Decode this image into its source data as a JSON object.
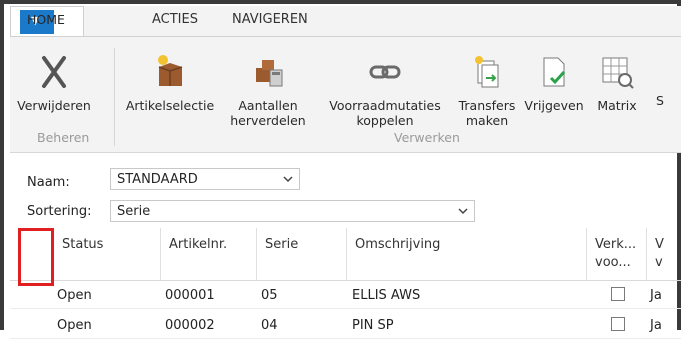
{
  "tabs": [
    {
      "label": "HOME",
      "active": true
    },
    {
      "label": "ACTIES"
    },
    {
      "label": "NAVIGEREN"
    }
  ],
  "ribbon": {
    "groups": {
      "beheren": "Beheren",
      "verwerken": "Verwerken"
    },
    "buttons": {
      "delete": "Verwijderen",
      "item_selection": "Artikelselectie",
      "redistribute_1": "Aantallen",
      "redistribute_2": "herverdelen",
      "inventory_1": "Voorraadmutaties",
      "inventory_2": "koppelen",
      "transfers_1": "Transfers",
      "transfers_2": "maken",
      "release": "Vrijgeven",
      "matrix": "Matrix",
      "cut_off": "S"
    }
  },
  "form": {
    "name_label": "Naam:",
    "name_value": "STANDAARD",
    "sort_label": "Sortering:",
    "sort_value": "Serie"
  },
  "grid": {
    "columns": {
      "status": "Status",
      "item_no": "Artikelnr.",
      "series": "Serie",
      "description": "Omschrijving",
      "sales_1": "Verk...",
      "sales_2": "voo...",
      "cut_1": "V",
      "cut_2": "v"
    },
    "rows": [
      {
        "status": "Open",
        "item_no": "000001",
        "series": "05",
        "description": "ELLIS AWS",
        "checked": false,
        "cut": "Ja"
      },
      {
        "status": "Open",
        "item_no": "000002",
        "series": "04",
        "description": "PIN SP",
        "checked": false,
        "cut": "Ja"
      }
    ]
  },
  "colors": {
    "accent": "#1b79c9",
    "highlight": "#e02020"
  }
}
